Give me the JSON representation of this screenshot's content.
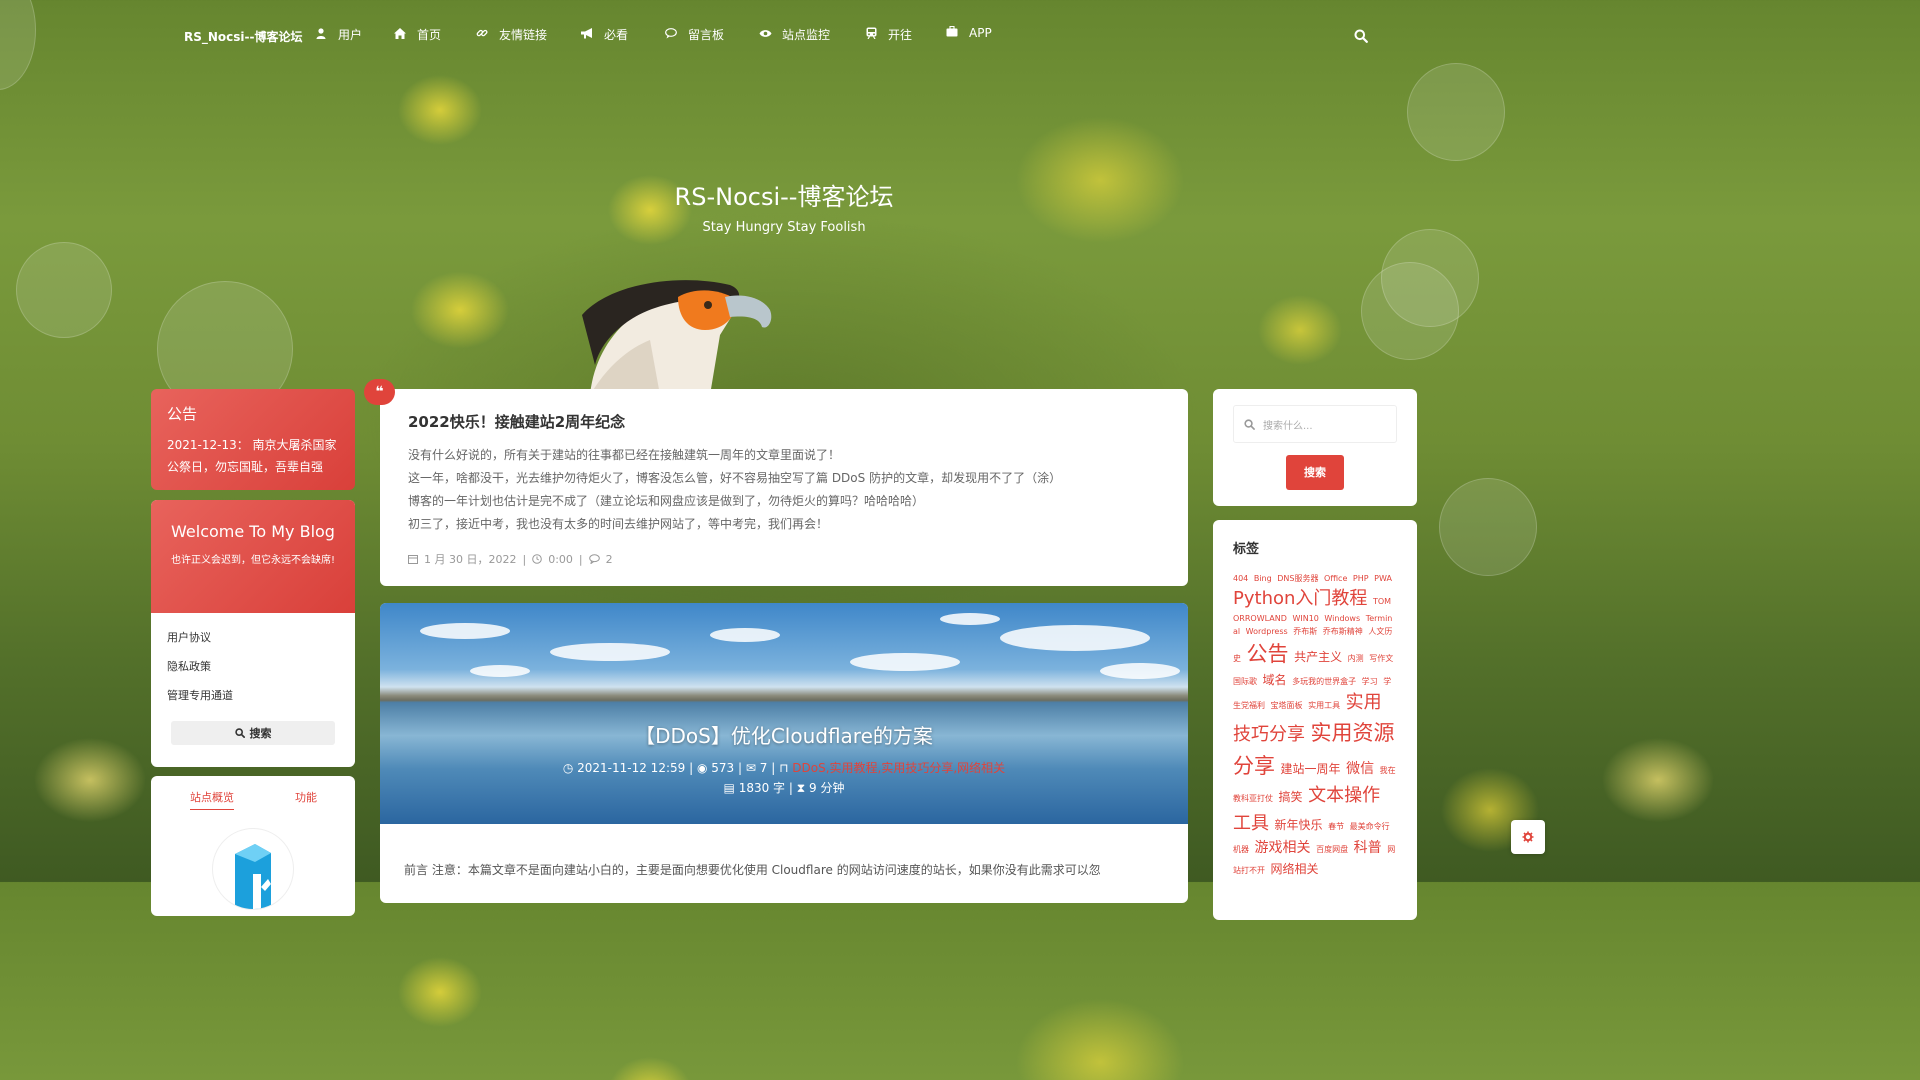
{
  "nav": {
    "brand": "RS_Nocsi--博客论坛",
    "items": [
      {
        "label": "用户",
        "icon": "user-icon"
      },
      {
        "label": "首页",
        "icon": "home-icon"
      },
      {
        "label": "友情链接",
        "icon": "link-icon"
      },
      {
        "label": "必看",
        "icon": "bullhorn-icon"
      },
      {
        "label": "留言板",
        "icon": "comment-icon"
      },
      {
        "label": "站点监控",
        "icon": "eye-icon"
      },
      {
        "label": "开往",
        "icon": "train-icon"
      },
      {
        "label": "APP",
        "icon": "briefcase-icon"
      }
    ]
  },
  "hero": {
    "title": "RS-Nocsi--博客论坛",
    "subtitle": "Stay Hungry Stay Foolish"
  },
  "notice": {
    "title": "公告",
    "text": "2021-12-13： 南京大屠杀国家公祭日，勿忘国耻，吾辈自强"
  },
  "welcome": {
    "title": "Welcome To My Blog",
    "motto": "也许正义会迟到，但它永远不会缺席!",
    "links": [
      "用户协议",
      "隐私政策",
      "管理专用通道"
    ],
    "search_label": "搜索"
  },
  "stats": {
    "tabs": [
      "站点概览",
      "功能"
    ]
  },
  "post1": {
    "title": "2022快乐！接触建站2周年纪念",
    "lines": [
      "没有什么好说的，所有关于建站的往事都已经在接触建筑一周年的文章里面说了！",
      "这一年，啥都没干，光去维护勿待炬火了，博客没怎么管，好不容易抽空写了篇 DDoS 防护的文章，却发现用不了了（涂）",
      "博客的一年计划也估计是完不成了（建立论坛和网盘应该是做到了，勿待炬火的算吗？哈哈哈哈）",
      "初三了，接近中考，我也没有太多的时间去维护网站了，等中考完，我们再会！"
    ],
    "date": "1 月 30 日，2022",
    "time": "0:00",
    "comments": "2"
  },
  "post2": {
    "title": "【DDoS】优化Cloudflare的方案",
    "date": "2021-11-12 12:59",
    "views": "573",
    "comments": "7",
    "tags": "DDoS,实用教程,实用技巧分享,网络相关",
    "words": "1830 字",
    "read_time": "9 分钟",
    "excerpt": "前言 注意：本篇文章不是面向建站小白的，主要是面向想要优化使用 Cloudflare 的网站访问速度的站长，如果你没有此需求可以忽"
  },
  "search": {
    "placeholder": "搜索什么...",
    "button": "搜索"
  },
  "tags": {
    "title": "标签",
    "items": [
      {
        "t": "404",
        "s": "xs"
      },
      {
        "t": "Bing",
        "s": "xs"
      },
      {
        "t": "DNS服务器",
        "s": "xs"
      },
      {
        "t": "Office",
        "s": "xs"
      },
      {
        "t": "PHP",
        "s": "xs"
      },
      {
        "t": "PWA",
        "s": "xs"
      },
      {
        "t": "Python入门教程",
        "s": "xl"
      },
      {
        "t": "TOMORROWLAND",
        "s": "xs"
      },
      {
        "t": "WIN10",
        "s": "xs"
      },
      {
        "t": "Windows",
        "s": "xs"
      },
      {
        "t": "Terminal",
        "s": "xs"
      },
      {
        "t": "Wordpress",
        "s": "xs"
      },
      {
        "t": "乔布斯",
        "s": "xs"
      },
      {
        "t": "乔布斯精神",
        "s": "xs"
      },
      {
        "t": "人文历史",
        "s": "xs"
      },
      {
        "t": "公告",
        "s": "xxl"
      },
      {
        "t": "共产主义",
        "s": "m"
      },
      {
        "t": "内测",
        "s": "xs"
      },
      {
        "t": "写作文",
        "s": "xs"
      },
      {
        "t": "国际歌",
        "s": "xs"
      },
      {
        "t": "域名",
        "s": "m"
      },
      {
        "t": "多玩我的世界盒子",
        "s": "xs"
      },
      {
        "t": "学习",
        "s": "xs"
      },
      {
        "t": "学生党福利",
        "s": "xs"
      },
      {
        "t": "宝塔面板",
        "s": "xs"
      },
      {
        "t": "实用工具",
        "s": "xs"
      },
      {
        "t": "实用技巧分享",
        "s": "xl"
      },
      {
        "t": "实用资源分享",
        "s": "xxl"
      },
      {
        "t": "建站一周年",
        "s": "m"
      },
      {
        "t": "微信",
        "s": "l"
      },
      {
        "t": "我在教科亚打仗",
        "s": "xs"
      },
      {
        "t": "搞笑",
        "s": "m"
      },
      {
        "t": "文本操作工具",
        "s": "xl"
      },
      {
        "t": "新年快乐",
        "s": "m"
      },
      {
        "t": "春节",
        "s": "xs"
      },
      {
        "t": "最美命令行",
        "s": "xs"
      },
      {
        "t": "机器",
        "s": "xs"
      },
      {
        "t": "游戏相关",
        "s": "l"
      },
      {
        "t": "百度网盘",
        "s": "xs"
      },
      {
        "t": "科普",
        "s": "l"
      },
      {
        "t": "网站打不开",
        "s": "xs"
      },
      {
        "t": "网络相关",
        "s": "m"
      }
    ]
  },
  "colors": {
    "accent": "#e0443b",
    "text": "#333333",
    "muted": "#999999"
  }
}
